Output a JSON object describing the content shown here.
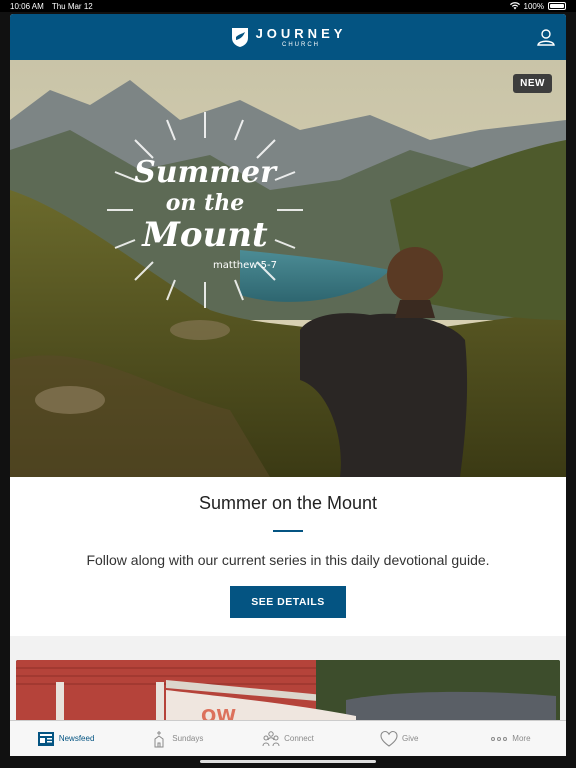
{
  "status_bar": {
    "time": "10:06 AM",
    "date": "Thu Mar 12",
    "battery": "100%"
  },
  "header": {
    "logo_title": "JOURNEY",
    "logo_subtitle": "CHURCH"
  },
  "featured": {
    "badge": "NEW",
    "title": "Summer on the Mount",
    "description": "Follow along with our current series in this daily devotional guide.",
    "button_label": "SEE DETAILS",
    "art_line1": "Summer",
    "art_line2": "on the",
    "art_line3": "Mount",
    "art_ref": "matthew 5-7"
  },
  "tabs": [
    {
      "label": "Newsfeed",
      "icon": "newsfeed-icon",
      "active": true
    },
    {
      "label": "Sundays",
      "icon": "church-icon",
      "active": false
    },
    {
      "label": "Connect",
      "icon": "people-icon",
      "active": false
    },
    {
      "label": "Give",
      "icon": "heart-icon",
      "active": false
    },
    {
      "label": "More",
      "icon": "more-dots-icon",
      "active": false
    }
  ],
  "colors": {
    "brand": "#045482",
    "badge": "#3d3d3d"
  }
}
